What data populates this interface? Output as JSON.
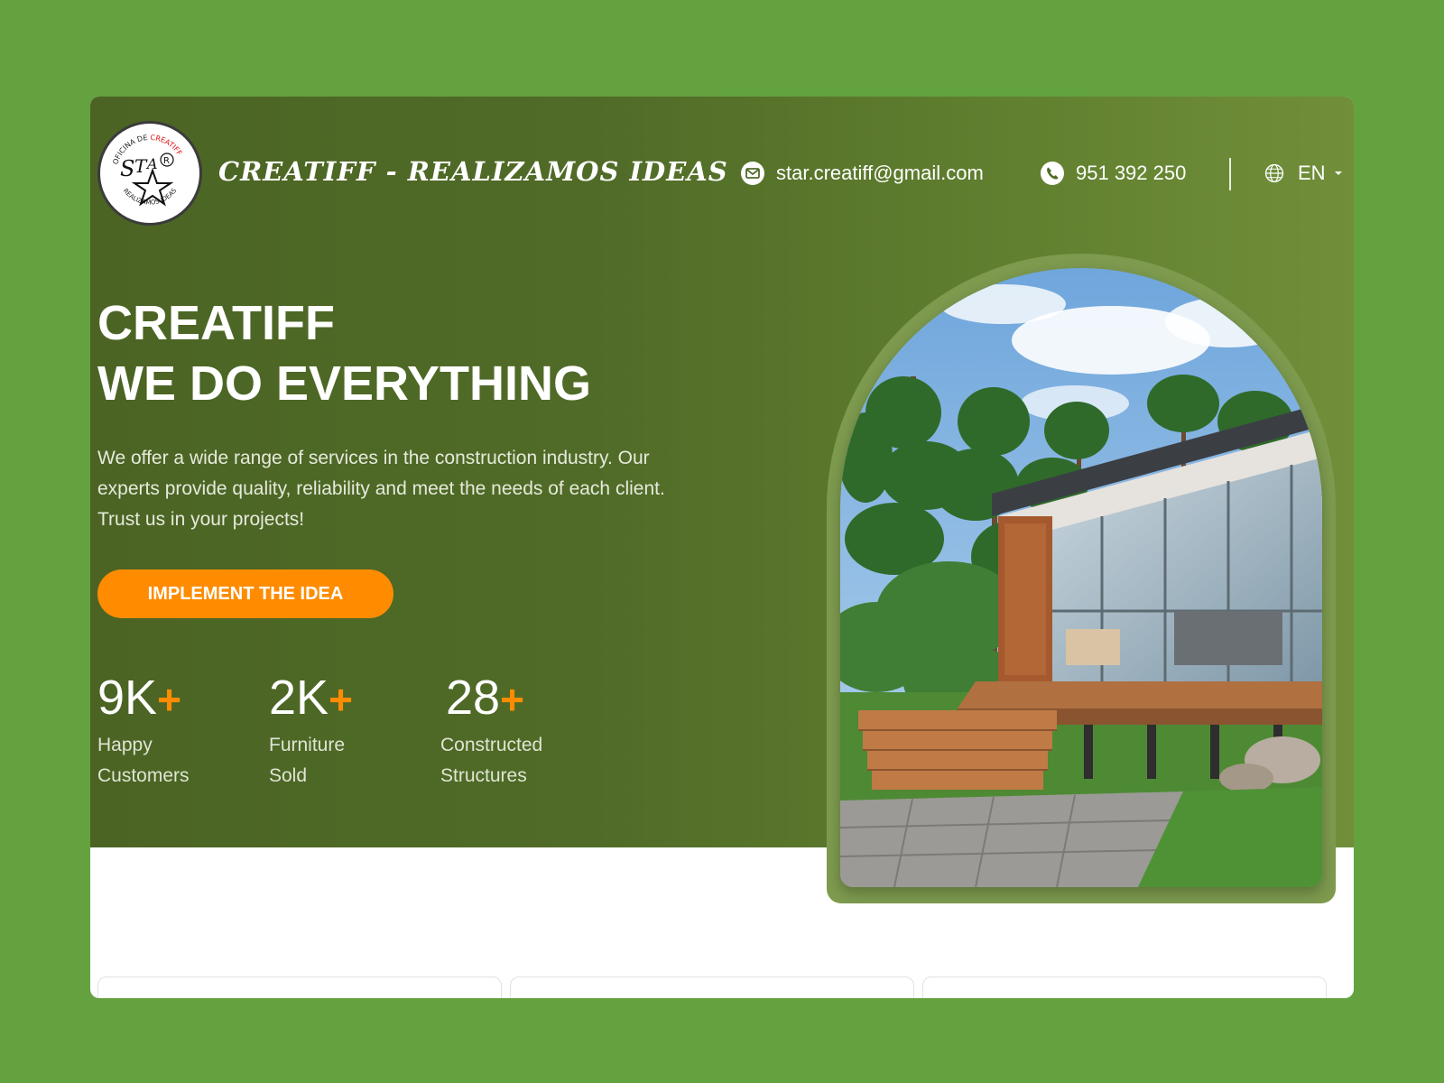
{
  "header": {
    "brand_title": "CREATIFF - REALIZAMOS IDEAS",
    "logo": {
      "top_text": "OFICINA DE CREATIFF",
      "bottom_text": "REALIZAMOS IDEAS",
      "center_text": "STAR"
    },
    "email": "star.creatiff@gmail.com",
    "phone": "951 392 250",
    "language": "EN"
  },
  "hero": {
    "title_line1": "CREATIFF",
    "title_line2": "WE DO EVERYTHING",
    "description": "We offer a wide range of services in the construction industry. Our experts provide quality, reliability and meet the needs of each client. Trust us in your projects!",
    "cta_label": "IMPLEMENT THE IDEA",
    "stats": [
      {
        "value": "9K",
        "plus": "+",
        "label_line1": "Happy",
        "label_line2": "Customers"
      },
      {
        "value": "2K",
        "plus": "+",
        "label_line1": "Furniture",
        "label_line2": "Sold"
      },
      {
        "value": "28",
        "plus": "+",
        "label_line1": "Constructed",
        "label_line2": "Structures"
      }
    ]
  },
  "colors": {
    "page_background": "#64a240",
    "hero_dark": "#4b6424",
    "hero_light": "#718f3a",
    "accent": "#ff8c00",
    "text": "#ffffff"
  },
  "icons": [
    "mail-icon",
    "phone-icon",
    "globe-icon",
    "caret-down-icon"
  ]
}
